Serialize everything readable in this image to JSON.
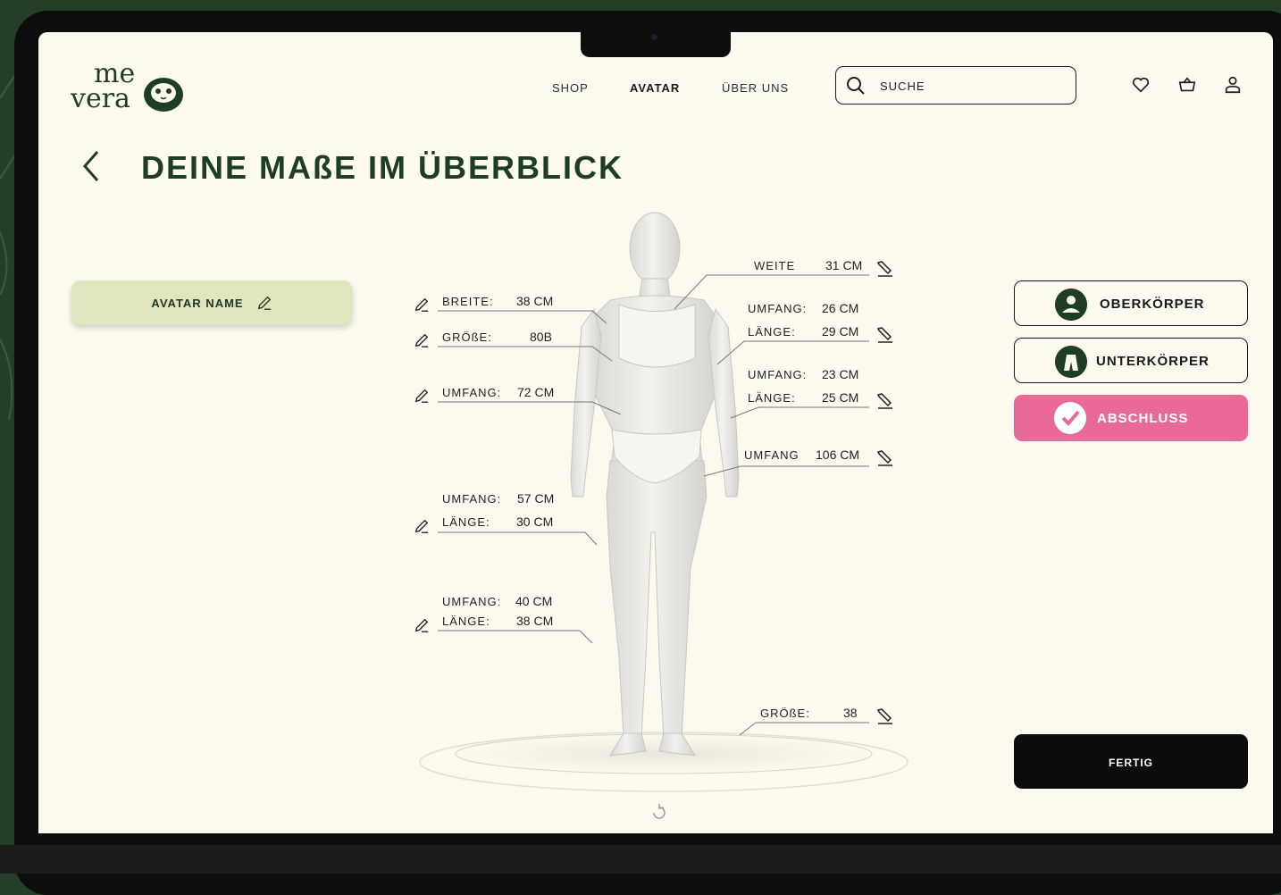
{
  "brand": {
    "logo_text_top": "me",
    "logo_text_bottom": "vera"
  },
  "nav": {
    "shop": "SHOP",
    "avatar": "AVATAR",
    "about": "ÜBER UNS"
  },
  "search": {
    "placeholder": "SUCHE"
  },
  "header_icons": [
    "heart-icon",
    "basket-icon",
    "user-icon"
  ],
  "page": {
    "title": "DEINE MAßE IM ÜBERBLICK"
  },
  "avatar_name": {
    "label": "AVATAR NAME"
  },
  "left_measurements": [
    {
      "label": "BREITE:",
      "value": "38 CM"
    },
    {
      "label": "GRÖßE:",
      "value": "80B"
    },
    {
      "label": "UMFANG:",
      "value": "72 CM"
    },
    {
      "label": "UMFANG:",
      "value": "57 CM"
    },
    {
      "label": "LÄNGE:",
      "value": "30 CM"
    },
    {
      "label": "UMFANG:",
      "value": "40 CM"
    },
    {
      "label": "LÄNGE:",
      "value": "38 CM"
    }
  ],
  "right_measurements": [
    {
      "label": "WEITE",
      "value": "31 CM"
    },
    {
      "label": "UMFANG:",
      "value": "26 CM"
    },
    {
      "label": "LÄNGE:",
      "value": "29 CM"
    },
    {
      "label": "UMFANG:",
      "value": "23 CM"
    },
    {
      "label": "LÄNGE:",
      "value": "25 CM"
    },
    {
      "label": "UMFANG",
      "value": "106 CM"
    },
    {
      "label": "GRÖßE:",
      "value": "38"
    }
  ],
  "side_nav": {
    "upper": "OBERKÖRPER",
    "lower": "UNTERKÖRPER",
    "finish": "ABSCHLUSS"
  },
  "done_button": {
    "label": "FERTIG"
  },
  "colors": {
    "brand_green": "#1f3d25",
    "pink": "#e96a98",
    "sage": "#dfe6bd",
    "page_bg": "#fcf9ef"
  }
}
